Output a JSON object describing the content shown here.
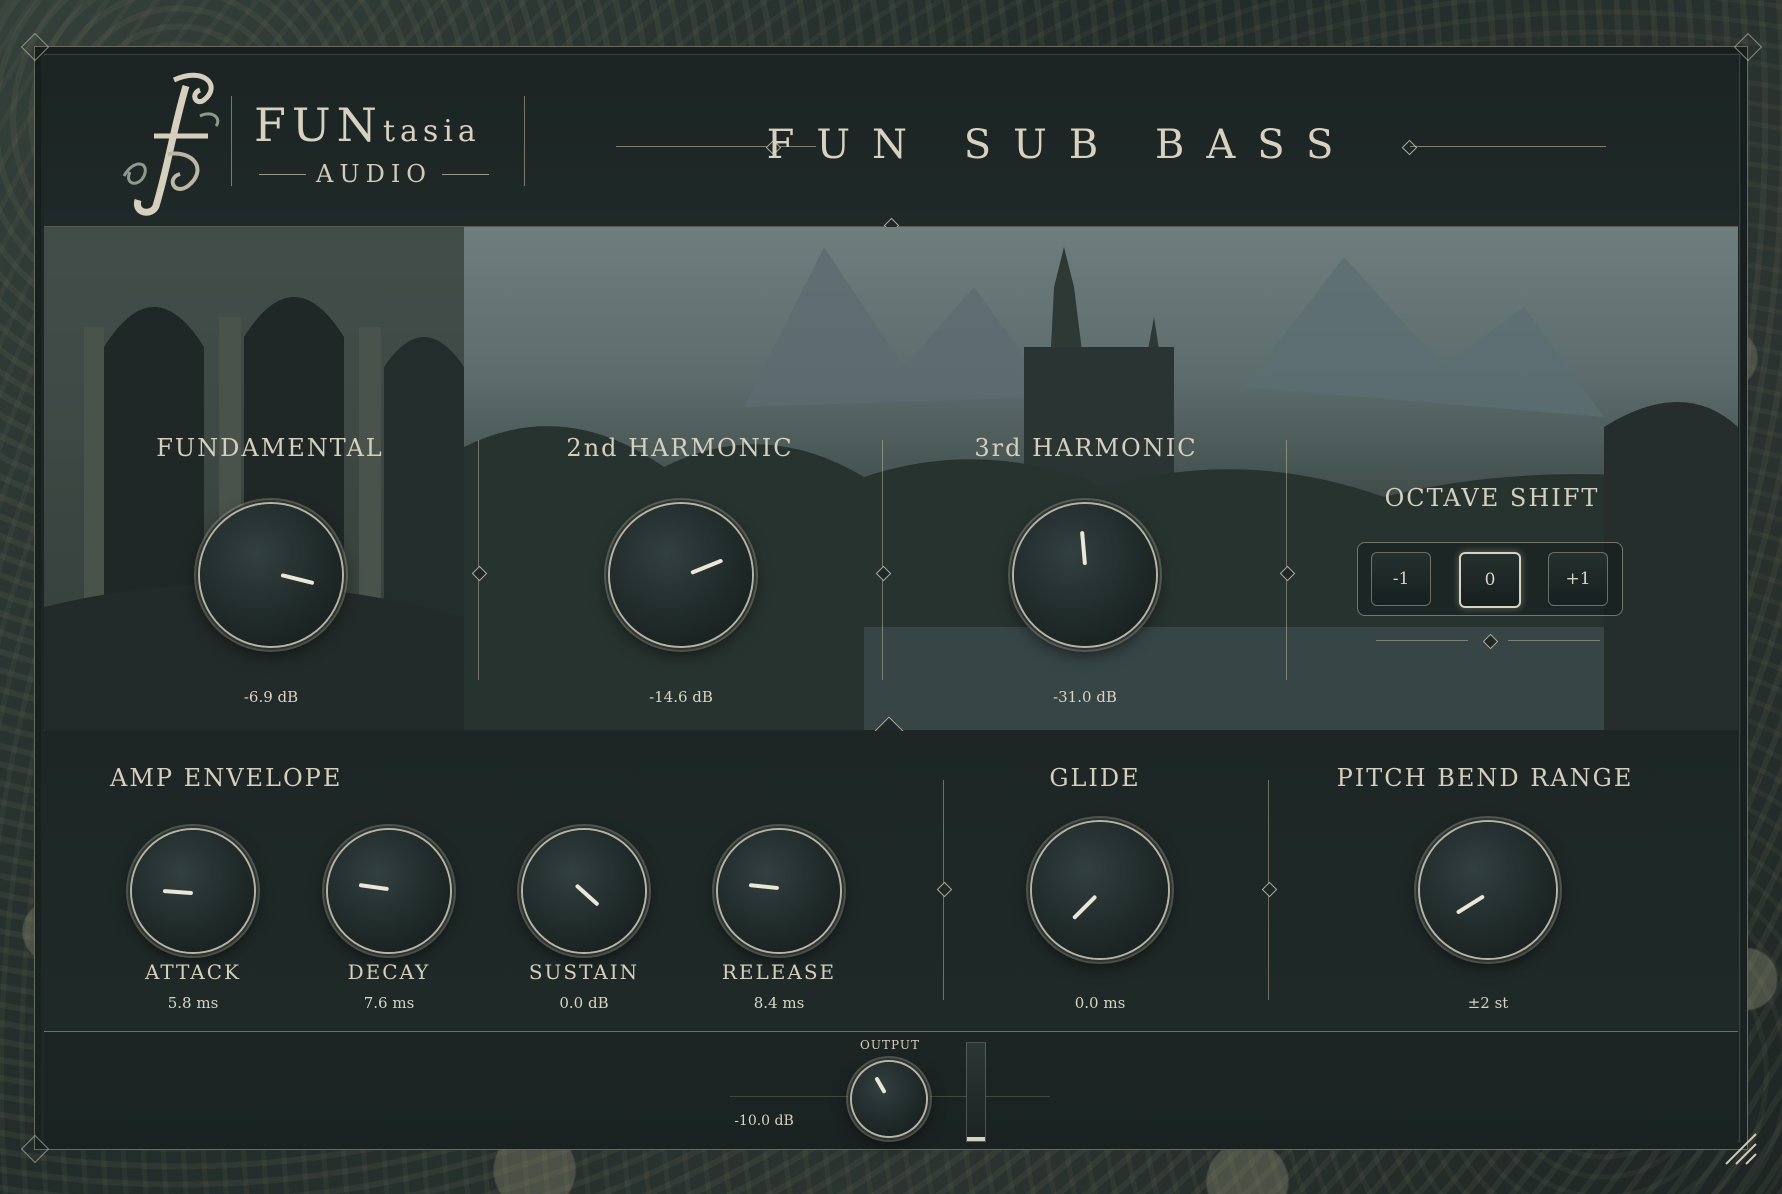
{
  "brand": {
    "name_big": "FUN",
    "name_small": "tasia",
    "sub": "AUDIO",
    "logo_letter": "f"
  },
  "title": "FUN SUB BASS",
  "harmonics": [
    {
      "label": "FUNDAMENTAL",
      "value": "-6.9 dB"
    },
    {
      "label": "2nd HARMONIC",
      "value": "-14.6 dB"
    },
    {
      "label": "3rd HARMONIC",
      "value": "-31.0 dB"
    }
  ],
  "octave": {
    "label": "OCTAVE SHIFT",
    "options": [
      "-1",
      "0",
      "+1"
    ],
    "selected": "0"
  },
  "amp_envelope": {
    "label": "AMP ENVELOPE",
    "knobs": [
      {
        "label": "ATTACK",
        "value": "5.8 ms"
      },
      {
        "label": "DECAY",
        "value": "7.6 ms"
      },
      {
        "label": "SUSTAIN",
        "value": "0.0 dB"
      },
      {
        "label": "RELEASE",
        "value": "8.4 ms"
      }
    ]
  },
  "glide": {
    "label": "GLIDE",
    "value": "0.0 ms"
  },
  "pitch_bend": {
    "label": "PITCH BEND RANGE",
    "value": "±2 st"
  },
  "output": {
    "label": "OUTPUT",
    "value": "-10.0 dB",
    "meter_level": 0.04
  },
  "colors": {
    "accent": "#d8d1bf",
    "panel": "#1e2827",
    "scene_sky": "#6f7e7d"
  }
}
